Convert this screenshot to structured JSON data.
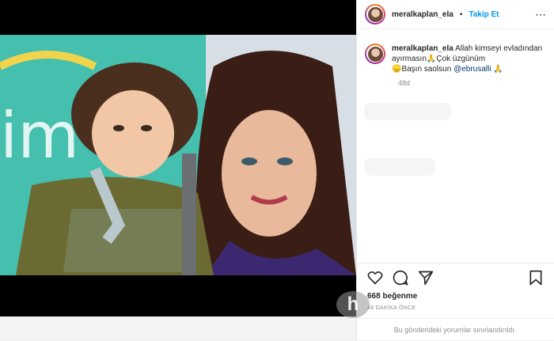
{
  "post": {
    "username": "meralkaplan_ela",
    "separator": "•",
    "follow_label": "Takip Et",
    "more_icon": "more-horizontal-icon",
    "caption_username": "meralkaplan_ela",
    "caption_line1": "Allah kimseyi evladından ayırmasın🙏Çok üzgünüm",
    "caption_line2": "😞Başın saolsun",
    "caption_mention": "@ebrusalli",
    "caption_end": "🙏",
    "time_ago": "48d",
    "likes": "668 beğenme",
    "post_time": "48 DAKİKA ÖNCE",
    "comments_limited": "Bu gönderideki yorumlar sınırlandırıldı."
  },
  "icons": {
    "like": "heart-icon",
    "comment": "comment-icon",
    "share": "share-icon",
    "save": "bookmark-icon"
  },
  "colors": {
    "follow_blue": "#0095f6",
    "mention": "#00376b",
    "muted": "#8e8e8e"
  },
  "watermark": "h"
}
